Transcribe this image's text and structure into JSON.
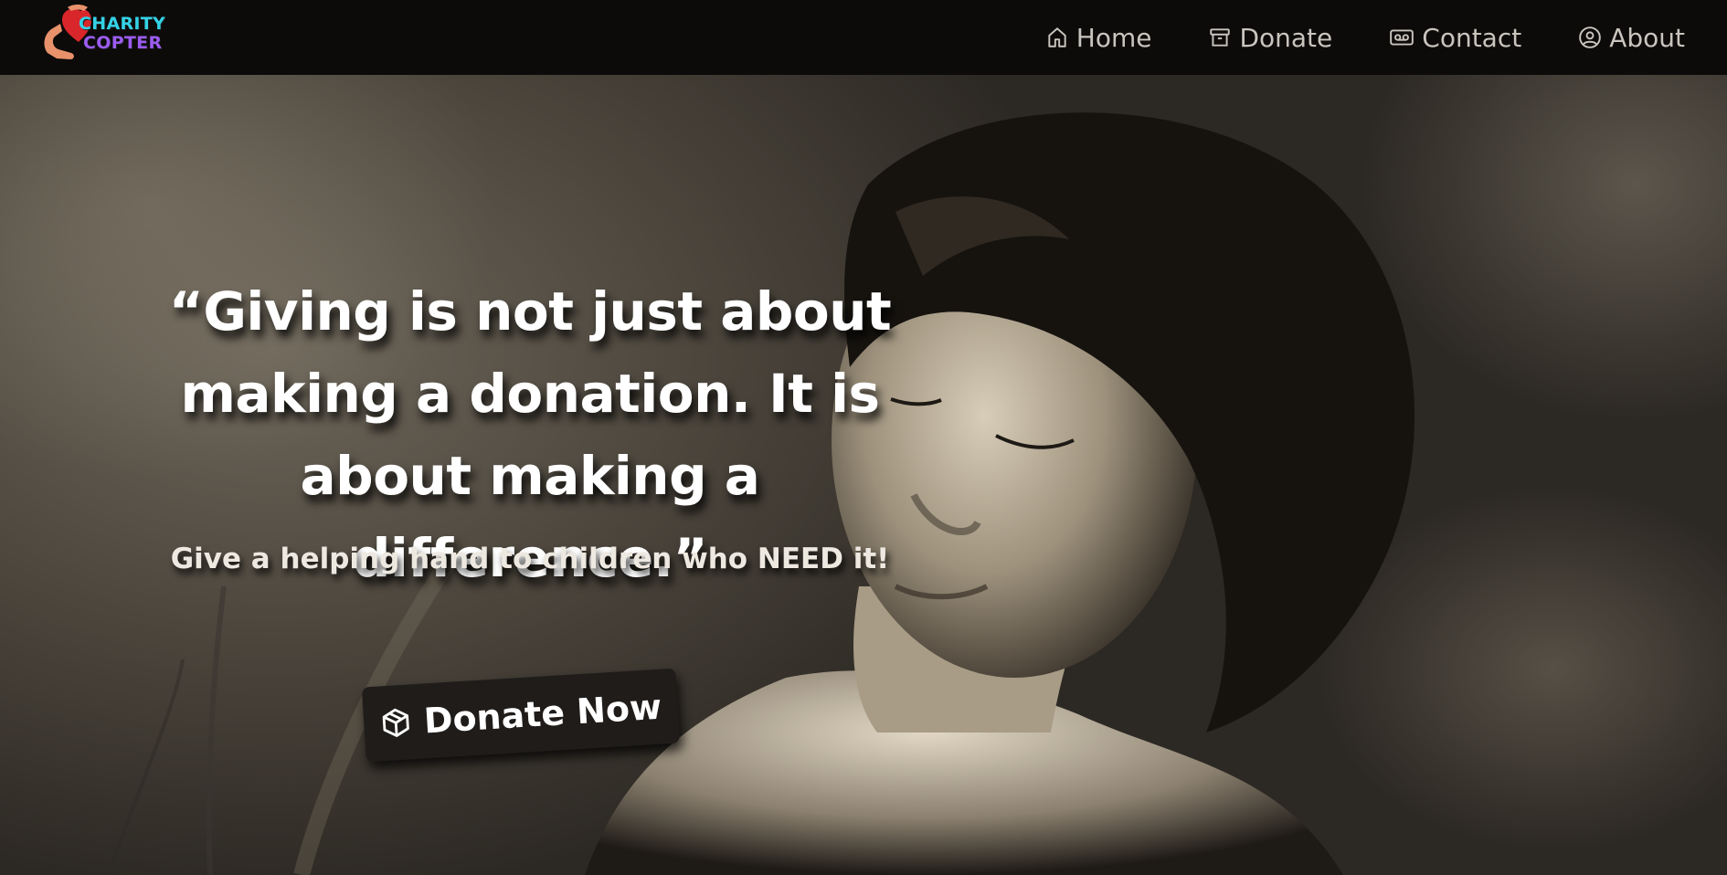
{
  "brand": {
    "line1": "CHARITY",
    "line2": "COPTER",
    "colors": {
      "line1": "#34d1e6",
      "line2": "#9b5cf0",
      "heart": "#d9262b",
      "hands": "#e8926b"
    }
  },
  "nav": {
    "items": [
      {
        "label": "Home",
        "icon": "home-icon"
      },
      {
        "label": "Donate",
        "icon": "archive-box-icon"
      },
      {
        "label": "Contact",
        "icon": "voicemail-icon"
      },
      {
        "label": "About",
        "icon": "user-circle-icon"
      }
    ]
  },
  "hero": {
    "quote_lines": [
      "“Giving is not just about",
      "making a donation. It is",
      "about making a difference.”"
    ],
    "subtitle": "Give a helping hand to children who NEED it!",
    "cta_label": "Donate Now",
    "cta_icon": "cube-icon",
    "background": "sepia photo of a child with eyes closed"
  }
}
